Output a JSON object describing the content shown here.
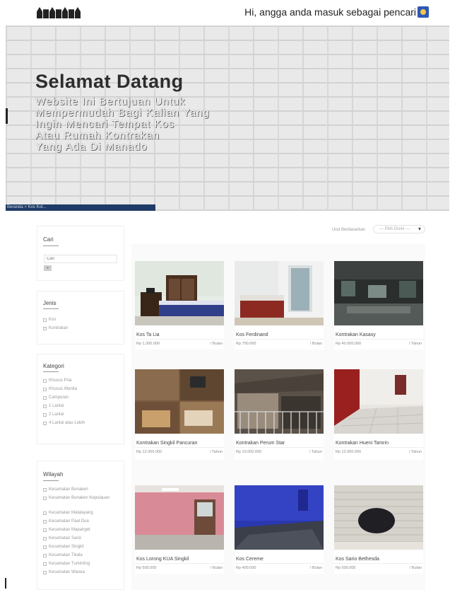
{
  "header": {
    "logo_icon": "houses-logo-icon",
    "greeting": "Hi, angga anda masuk sebagai pencari",
    "avatar_icon": "user-flag-icon"
  },
  "hero": {
    "title": "Selamat Datang",
    "text_lines": [
      "Website Ini Bertujuan Untuk",
      "Mempermudah Bagi Kalian Yang",
      "Ingin Mencari Tempat Kos",
      "Atau Rumah Kontrakan",
      "Yang Ada Di Manado"
    ],
    "breadcrumb": "Beranda > Kos Kot..."
  },
  "sidebar": {
    "search": {
      "title": "Cari",
      "placeholder": "Cari",
      "button_icon": "search-icon"
    },
    "jenis": {
      "title": "Jenis",
      "items": [
        "Kos",
        "Kontrakan"
      ]
    },
    "kategori": {
      "title": "Kategori",
      "items": [
        "Khusus Pria",
        "Khusus Wanita",
        "Campuran",
        "1 Lantai",
        "2 Lantai",
        "4 Lantai atau Lebih"
      ]
    },
    "wilayah": {
      "title": "Wilayah",
      "items": [
        "Kecamatan Bunaken",
        "Kecamatan Bunaken Kepulauan",
        "Kecamatan Malalayang",
        "Kecamatan Paal Dua",
        "Kecamatan Mapanget",
        "Kecamatan Sario",
        "Kecamatan Singkil",
        "Kecamatan Tikala",
        "Kecamatan Tuminting",
        "Kecamatan Wanea"
      ]
    }
  },
  "sort": {
    "label": "Urut Berdasarkan",
    "selected": "--- Pilih Disini ---"
  },
  "listings": [
    {
      "name": "Kos Ta Lia",
      "price": "Rp 1.300.000",
      "unit": "/ Bulan",
      "scene": "bedroom"
    },
    {
      "name": "Kos Ferdinand",
      "price": "Rp 750.000",
      "unit": "/ Bulan",
      "scene": "room-bed"
    },
    {
      "name": "Kontrakan Kasasy",
      "price": "Rp 40.000.000",
      "unit": "/ Tahun",
      "scene": "dark-hall"
    },
    {
      "name": "Kontrakan Singkil Pancuran",
      "price": "Rp 12.000.000",
      "unit": "/ Tahun",
      "scene": "living-collage"
    },
    {
      "name": "Kontrakan Perum Star",
      "price": "Rp 10.000.000",
      "unit": "/ Tahun",
      "scene": "house-front"
    },
    {
      "name": "Kontrakan Hueni Tamrin",
      "price": "Rp 12.000.000",
      "unit": "/ Tahun",
      "scene": "red-room"
    },
    {
      "name": "Kos Lorong KUA Singkil",
      "price": "Rp 500.000",
      "unit": "/ Bulan",
      "scene": "pink-room"
    },
    {
      "name": "Kos Cereme",
      "price": "Rp 400.000",
      "unit": "/ Bulan",
      "scene": "blue-room"
    },
    {
      "name": "Kos Sario Bethesda",
      "price": "Rp 500.000",
      "unit": "/ Bulan",
      "scene": "ceiling"
    }
  ],
  "colors": {
    "hero_bar": "#1f3b67",
    "flag": "#2f58b5"
  }
}
